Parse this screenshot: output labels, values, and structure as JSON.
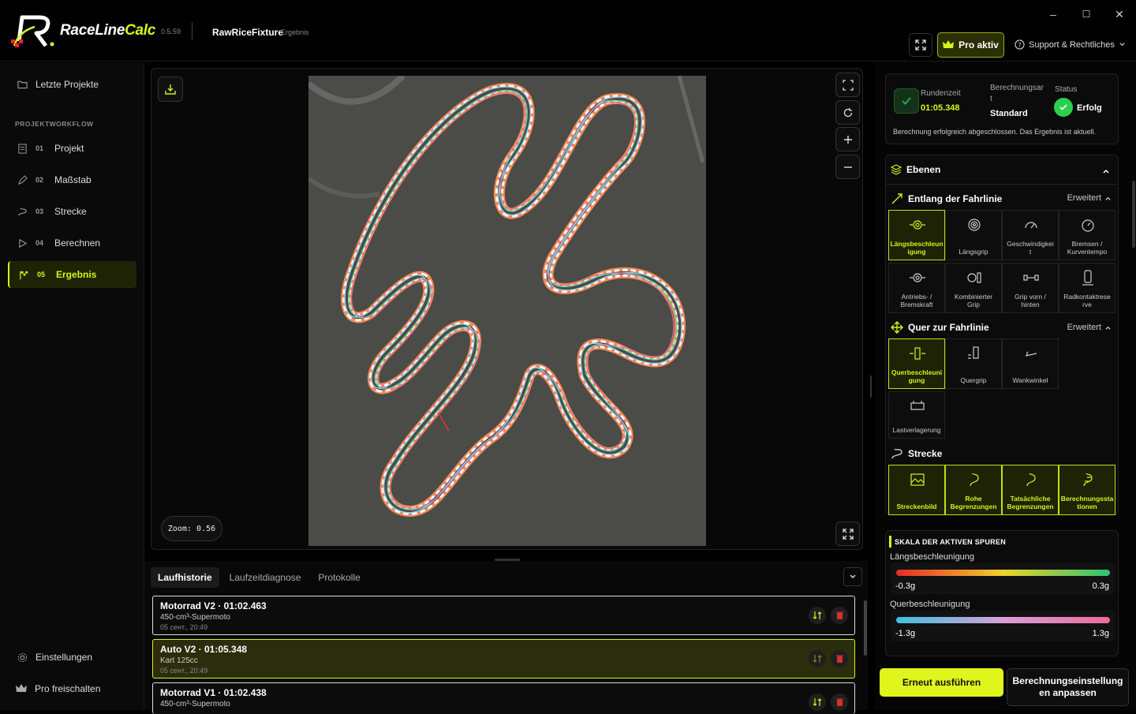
{
  "app": {
    "brand_main": "RaceLine",
    "brand_accent": "Calc",
    "version": "0.5.59",
    "project_name": "RawRiceFixture",
    "project_sub": "Ergebnis"
  },
  "window": {
    "minimize": "–",
    "maximize": "☐",
    "close": "✕"
  },
  "header": {
    "pro_label": "Pro aktiv",
    "support_label": "Support & Rechtliches"
  },
  "sidebar": {
    "recent": "Letzte Projekte",
    "workflow_label": "PROJEKTWORKFLOW",
    "items": [
      {
        "num": "01",
        "label": "Projekt"
      },
      {
        "num": "02",
        "label": "Maßstab"
      },
      {
        "num": "03",
        "label": "Strecke"
      },
      {
        "num": "04",
        "label": "Berechnen"
      },
      {
        "num": "05",
        "label": "Ergebnis"
      }
    ],
    "settings": "Einstellungen",
    "unlock": "Pro freischalten"
  },
  "viewer": {
    "zoom_text": "Zoom: 0.56"
  },
  "bottom": {
    "tabs": [
      "Laufhistorie",
      "Laufzeitdiagnose",
      "Protokolle"
    ],
    "runs": [
      {
        "title": "Motorrad V2 · 01:02.463",
        "sub": "450-cm³-Supermoto",
        "date": "05 сент., 20:49"
      },
      {
        "title": "Auto V2 · 01:05.348",
        "sub": "Kart 125cc",
        "date": "05 сент., 20:49"
      },
      {
        "title": "Motorrad V1 · 01:02.438",
        "sub": "450-cm³-Supermoto",
        "date": ""
      }
    ]
  },
  "status": {
    "lap_label": "Rundenzeit",
    "lap_value": "01:05.348",
    "mode_label_1": "Berechnungsar",
    "mode_label_2": "t",
    "mode_value": "Standard",
    "state_label": "Status",
    "state_value": "Erfolg",
    "message": "Berechnung erfolgreich abgeschlossen. Das Ergebnis ist aktuell."
  },
  "layers": {
    "title": "Ebenen",
    "along": {
      "title": "Entlang der Fahrlinie",
      "mode": "Erweitert",
      "tiles": [
        {
          "l1": "Längsbeschleun",
          "l2": "igung",
          "icon": "gauge-arrows-icon"
        },
        {
          "l1": "Längsgrip",
          "l2": "",
          "icon": "tire-icon"
        },
        {
          "l1": "Geschwindigkei",
          "l2": "t",
          "icon": "speedometer-icon"
        },
        {
          "l1": "Bremsen /",
          "l2": "Kurventempo",
          "icon": "brake-gauge-icon"
        },
        {
          "l1": "Antriebs- /",
          "l2": "Bremskraft",
          "icon": "drive-force-icon"
        },
        {
          "l1": "Kombinierter",
          "l2": "Grip",
          "icon": "combined-grip-icon"
        },
        {
          "l1": "Grip vorn /",
          "l2": "hinten",
          "icon": "axle-grip-icon"
        },
        {
          "l1": "Radkontaktrese",
          "l2": "rve",
          "icon": "wheel-contact-icon"
        }
      ]
    },
    "across": {
      "title": "Quer zur Fahrlinie",
      "mode": "Erweitert",
      "tiles": [
        {
          "l1": "Querbeschleuni",
          "l2": "gung",
          "icon": "lateral-accel-icon"
        },
        {
          "l1": "Quergrip",
          "l2": "",
          "icon": "lateral-grip-icon"
        },
        {
          "l1": "Wankwinkel",
          "l2": "",
          "icon": "roll-angle-icon"
        },
        {
          "l1": "Lastverlagerung",
          "l2": "",
          "icon": "load-transfer-icon"
        }
      ]
    },
    "track": {
      "title": "Strecke",
      "tiles": [
        {
          "l1": "Streckenbild",
          "l2": "",
          "icon": "image-icon"
        },
        {
          "l1": "Rohe",
          "l2": "Begrenzungen",
          "icon": "raw-bounds-icon"
        },
        {
          "l1": "Tatsächliche",
          "l2": "Begrenzungen",
          "icon": "actual-bounds-icon"
        },
        {
          "l1": "Berechnungssta",
          "l2": "tionen",
          "icon": "stations-icon"
        }
      ]
    }
  },
  "scale": {
    "title": "SKALA DER AKTIVEN SPUREN",
    "long": {
      "label": "Längsbeschleunigung",
      "min": "-0.3g",
      "max": "0.3g"
    },
    "lat": {
      "label": "Querbeschleunigung",
      "min": "-1.3g",
      "max": "1.3g"
    }
  },
  "actions": {
    "rerun": "Erneut ausführen",
    "adjust_1": "Berechnungseinstellung",
    "adjust_2": "en anpassen"
  },
  "colors": {
    "accent": "#d8f21d",
    "success": "#27c93f",
    "delete": "#d6322d"
  }
}
